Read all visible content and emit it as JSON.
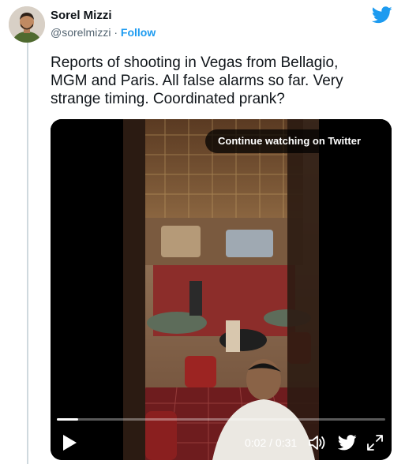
{
  "tweet": {
    "author_name": "Sorel Mizzi",
    "author_handle": "@sorelmizzi",
    "separator": " · ",
    "follow_label": "Follow",
    "text": "Reports of shooting in Vegas from Bellagio,\nMGM and Paris. All false alarms so far. Very\nstrange timing. Coordinated prank?"
  },
  "video": {
    "overlay_label": "Continue watching on Twitter",
    "time_display": "0:02 / 0:31",
    "progress_fraction": 0.065
  },
  "icons": {
    "brand": "twitter-bird-icon",
    "play": "play-icon",
    "volume": "volume-icon",
    "fullscreen": "fullscreen-icon"
  },
  "colors": {
    "accent": "#1d9bf0",
    "text": "#0f1419",
    "muted": "#536471"
  }
}
